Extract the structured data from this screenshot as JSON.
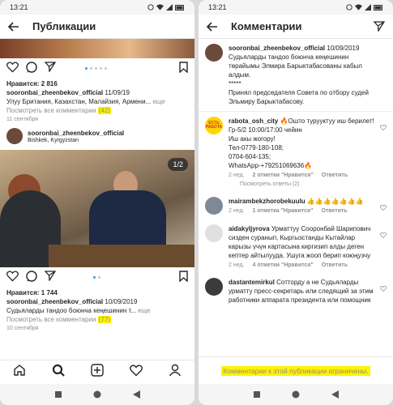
{
  "left": {
    "status_time": "13:21",
    "title": "Публикации",
    "post1": {
      "likes": "Нравится: 2 816",
      "author": "sooronbai_zheenbekov_official",
      "date": "11/09/19",
      "caption": "Улуу Британия, Казахстан, Малайзия, Армени...",
      "more": "еще",
      "view_comments": "Посмотреть все комментарии",
      "comment_count": "(42)",
      "time": "11 сентября"
    },
    "post2": {
      "author": "sooronbai_zheenbekov_official",
      "location": "Bishkek, Kyrgyzstan",
      "photo_counter": "1/2",
      "likes": "Нравится: 1 744",
      "caption_author": "sooronbai_zheenbekov_official",
      "caption_date": "10/09/2019",
      "caption": "Судьяларды тандоо боюнча кеңешинин т...",
      "more": "еще",
      "view_comments": "Посмотреть все комментарии",
      "comment_count": "(77)",
      "time": "10 сентября"
    }
  },
  "right": {
    "status_time": "13:21",
    "title": "Комментарии",
    "caption": {
      "author": "sooronbai_zheenbekov_official",
      "date": "10/09/2019",
      "text1": "Судьяларды тандоо боюнча кеңешинин төрайымы Элмира Барыктабасованы кабыл алдым.",
      "stars": "*****",
      "text2": "Принял председателя Совета по отбору судей Эльмиру Барыктабасову."
    },
    "comments": [
      {
        "author": "rabota_osh_city",
        "lines": [
          "🔥Ошто турууктуу иш берилет!",
          "Гр-5/2 10:00/17:00 чейин",
          "Иш акы жогору!",
          "Тел-0779-180-108;",
          "0704-604-135;",
          "WhatsApp-+79251069636🔥"
        ],
        "time": "2 нед.",
        "likes": "2 отметки \"Нравится\"",
        "reply": "Ответить",
        "view_replies": "Посмотреть ответы (2)",
        "avatar_text": "ЕСТЬ РАБОТА"
      },
      {
        "author": "mairambekzhorobekuulu",
        "lines": [
          "👍👍👍👍👍👍👍"
        ],
        "time": "2 нед.",
        "likes": "1 отметка \"Нравится\"",
        "reply": "Ответить"
      },
      {
        "author": "aidakyljyrova",
        "lines": [
          "Урматтуу Сооронбай Шарипович сизден суранып, Кыргызстанды Кытайлар карызы үчүн картасына киргизип алды деген кептер айтылууда. Ушуга жооп берип коюңузчу"
        ],
        "time": "2 нед.",
        "likes": "4 отметки \"Нравится\"",
        "reply": "Ответить"
      },
      {
        "author": "dastantemirkul",
        "lines": [
          "Сотторду а не Судьяларды урматту пресс-секретарь или следящий за этим работники аппарата президента или помощник"
        ]
      }
    ],
    "limited_notice": "Комментарии к этой публикации ограничены."
  }
}
